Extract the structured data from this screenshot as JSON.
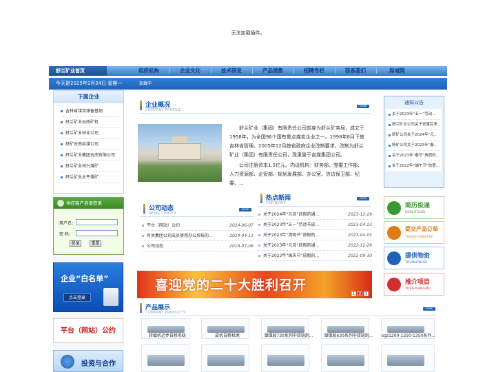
{
  "plugin_msg": "无法加载插件。",
  "nav": {
    "home": "舒兰矿业首页",
    "items": [
      "组织机构",
      "企业文化",
      "技术研发",
      "产品销售",
      "招聘专栏",
      "联系我们",
      "局域网"
    ]
  },
  "datebar": {
    "date": "今天是2025年2月24日 星期一",
    "loading": "加载中"
  },
  "subsidiaries": {
    "title": "下属企业",
    "items": [
      "吉林省煤炭储备基地",
      "舒兰矿业云南矿机",
      "舒兰矿业林业公司",
      "舒矿云南岩煤公司",
      "舒兰矿业集团云南有限公司",
      "舒兰矿业祥兴煤矿",
      "舒兰矿业太平煤矿"
    ]
  },
  "login": {
    "title": "供应客户目录登录",
    "user_label": "用户名：",
    "pass_label": "密  码：",
    "login_btn": "登录",
    "reset_btn": "重置"
  },
  "whitelist": {
    "title": "企业“白名单”",
    "button": "点击登录"
  },
  "pact": "平台（网站）公约",
  "invest": "投资与合作",
  "overview": {
    "title": "企业概况",
    "subtitle": "COMPANY PROFILE",
    "more": "MORE",
    "p1": "舒兰矿业（集团）有限责任公司前身为舒兰矿务局，成立于1958年，为全国96个国有重点煤炭企业之一。1998年8月下放吉林省管理。2005年12月按省政府企业改制要求，改制为舒兰矿业（集团）有限责任公司，现隶属于吉煤集团公司。",
    "p2": "公司注册资本1.5亿元。内设机构：财务部、党委工作部、人力资源部、企管部、规划发展部、办公室、信访保卫部、纪委、..."
  },
  "company_news": {
    "title": "公司动态",
    "subtitle": "NEWS CENTER",
    "more": "MORE",
    "items": [
      {
        "t": "平台（网站）公约",
        "d": "2024-06-07"
      },
      {
        "t": "有关集团公司成员使用办公系统的...",
        "d": "2024-04-11"
      },
      {
        "t": "公司动态",
        "d": "2018-07-06"
      }
    ]
  },
  "hot_news": {
    "title": "热点新闻",
    "subtitle": "TOP NEWS",
    "more": "MORE",
    "items": [
      {
        "t": "关于2024年“元旦”放假的通...",
        "d": "2023-12-29"
      },
      {
        "t": "关于2023年“五一”劳动节放...",
        "d": "2023-04-23"
      },
      {
        "t": "关于2023年“清明节”放假的...",
        "d": "2023-04-03"
      },
      {
        "t": "关于2023年“元旦”放假的通...",
        "d": "2022-12-29"
      },
      {
        "t": "关于2022年“国庆节”放假的...",
        "d": "2022-09-30"
      }
    ]
  },
  "banner": {
    "text": "喜迎党的二十大胜利召开",
    "pages": [
      "1",
      "2",
      "3"
    ]
  },
  "products": {
    "title": "产品展示",
    "subtitle": "COMPANY PRODUCTS",
    "more": "MORE",
    "items": [
      "转载机迈步自移系统",
      "皮机自移机尾",
      "薄煤层730系列中双链刮...",
      "薄煤层630系列中双链刮...",
      "sgz1200-1250-1350系列..."
    ]
  },
  "notice": {
    "title": "通知公告",
    "items": [
      "关于2023年“五一”劳动...",
      "舒兰矿业公司关于安置后来...",
      "舒矿公司关于2024年“元...",
      "舒矿公司关于2023年“春...",
      "关于2023年“春节”放假的...",
      "关于2022年“端午节”放假..."
    ]
  },
  "side_buttons": [
    {
      "t": "简历投递",
      "s": "JIANLITOUDI",
      "color": "#3a9a2f"
    },
    {
      "t": "提交产品订单",
      "s": "TIJIAOCHANGPIN",
      "color": "#e07a12"
    },
    {
      "t": "提供物资",
      "s": "TIGONGWUZI",
      "color": "#1f63b8"
    },
    {
      "t": "推介项目",
      "s": "TUIJIEXIANGMU",
      "color": "#d42d2d"
    }
  ]
}
